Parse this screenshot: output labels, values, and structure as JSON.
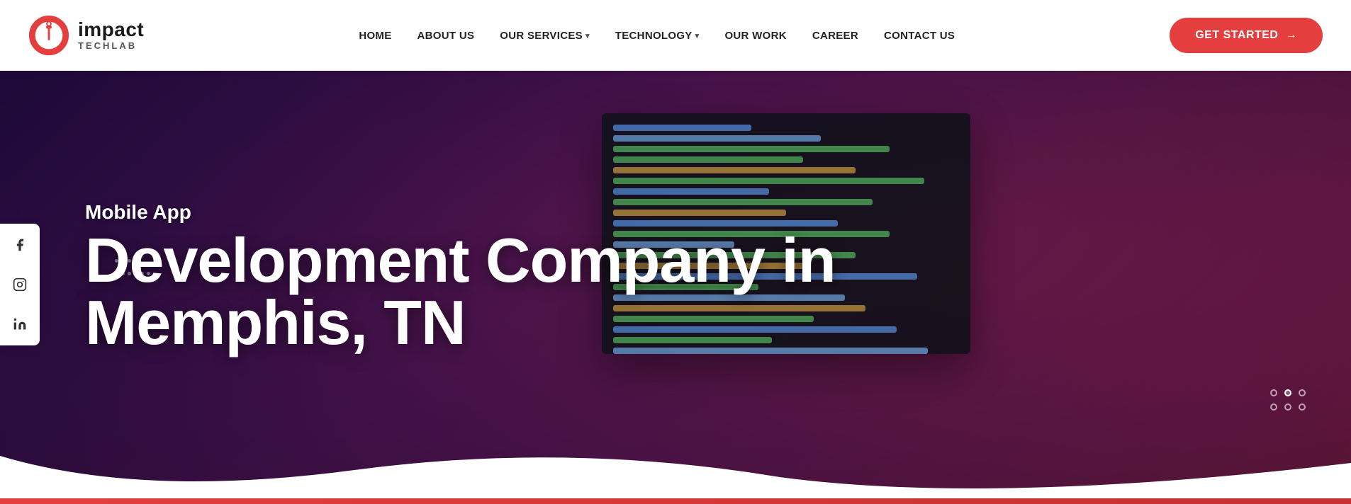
{
  "header": {
    "logo": {
      "brand": "impact",
      "sub": "TECHLAB"
    },
    "nav": [
      {
        "id": "home",
        "label": "HOME",
        "hasDropdown": false
      },
      {
        "id": "about",
        "label": "ABOUT US",
        "hasDropdown": false
      },
      {
        "id": "services",
        "label": "OUR SERVICES",
        "hasDropdown": true
      },
      {
        "id": "technology",
        "label": "TECHNOLOGY",
        "hasDropdown": true
      },
      {
        "id": "work",
        "label": "OUR WORK",
        "hasDropdown": false
      },
      {
        "id": "career",
        "label": "CAREER",
        "hasDropdown": false
      },
      {
        "id": "contact",
        "label": "CONTACT US",
        "hasDropdown": false
      }
    ],
    "cta": {
      "label": "GET STARTED",
      "arrow": "→"
    }
  },
  "hero": {
    "subtitle": "Mobile App",
    "title_line1": "Development Company in",
    "title_line2": "Memphis, TN",
    "social": [
      {
        "id": "facebook",
        "icon": "f",
        "label": "Facebook"
      },
      {
        "id": "instagram",
        "icon": "◎",
        "label": "Instagram"
      },
      {
        "id": "linkedin",
        "icon": "in",
        "label": "LinkedIn"
      }
    ],
    "slide_dots": [
      {
        "active": false
      },
      {
        "active": false
      },
      {
        "active": false
      },
      {
        "active": false
      },
      {
        "active": false
      },
      {
        "active": false
      }
    ]
  },
  "colors": {
    "brand_red": "#e53e3e",
    "nav_text": "#222222",
    "white": "#ffffff"
  }
}
